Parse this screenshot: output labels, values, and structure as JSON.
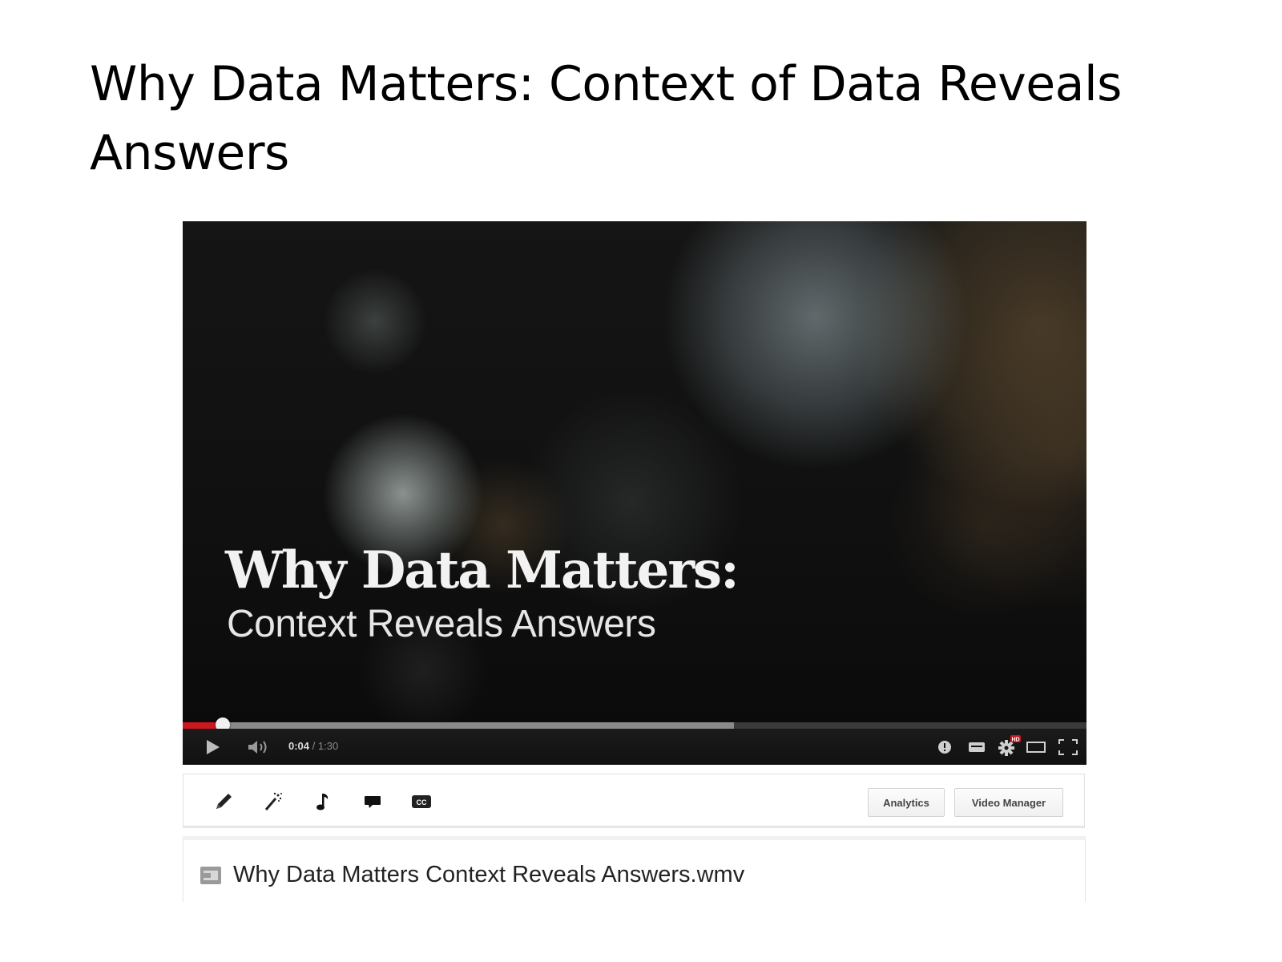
{
  "slide": {
    "title": "Why Data Matters: Context of Data Reveals Answers"
  },
  "video": {
    "overlay_title": "Why Data Matters:",
    "overlay_subtitle": "Context Reveals Answers"
  },
  "player": {
    "current_time": "0:04",
    "separator": " / ",
    "duration": "1:30",
    "progress_fraction": 0.0444,
    "buffered_fraction": 0.61,
    "accent_color": "#cc181e",
    "controls": {
      "play_icon": "play-icon",
      "volume_icon": "volume-icon",
      "info_icon": "info-icon",
      "annotations_icon": "annotations-icon",
      "settings_icon": "gear-icon",
      "hd_badge": "HD",
      "theater_icon": "theater-mode-icon",
      "fullscreen_icon": "fullscreen-icon"
    }
  },
  "toolbar": {
    "tools": [
      "pencil-icon",
      "magic-wand-icon",
      "music-note-icon",
      "speech-bubble-icon",
      "cc-icon"
    ],
    "cc_label": "CC",
    "analytics_label": "Analytics",
    "video_manager_label": "Video Manager"
  },
  "file": {
    "icon": "video-file-icon",
    "name": "Why Data Matters Context Reveals Answers.wmv"
  }
}
